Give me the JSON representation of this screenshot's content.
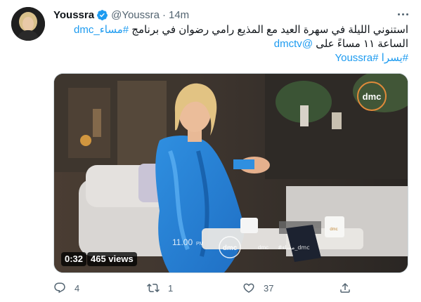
{
  "tweet": {
    "author_name": "Youssra",
    "handle": "@Youssra",
    "separator": "·",
    "time": "14m",
    "text_line1": "استنوني الليلة في سهرة العيد مع المذيع رامي رضوان في برنامج",
    "text_line1_hashtag": "#مساء_dmc",
    "text_line2": "الساعة ١١ مساءً على",
    "text_line2_mention": "@dmctv",
    "text_line3_hashtags": [
      "#يسرا",
      "#Youssra"
    ]
  },
  "video": {
    "duration": "0:32",
    "views": "465 views",
    "channel_logo": "dmc",
    "overlay_time": "11.00",
    "overlay_time_suffix": "PM",
    "overlay_small_text": "dmc",
    "overlay_hashtag": "#مساء_dmc",
    "mug_logo": "dmc"
  },
  "actions": {
    "reply_count": "4",
    "retweet_count": "1",
    "like_count": "37",
    "share_count": ""
  },
  "colors": {
    "link": "#1d9bf0",
    "secondary_text": "#536471",
    "verified": "#1d9bf0"
  }
}
